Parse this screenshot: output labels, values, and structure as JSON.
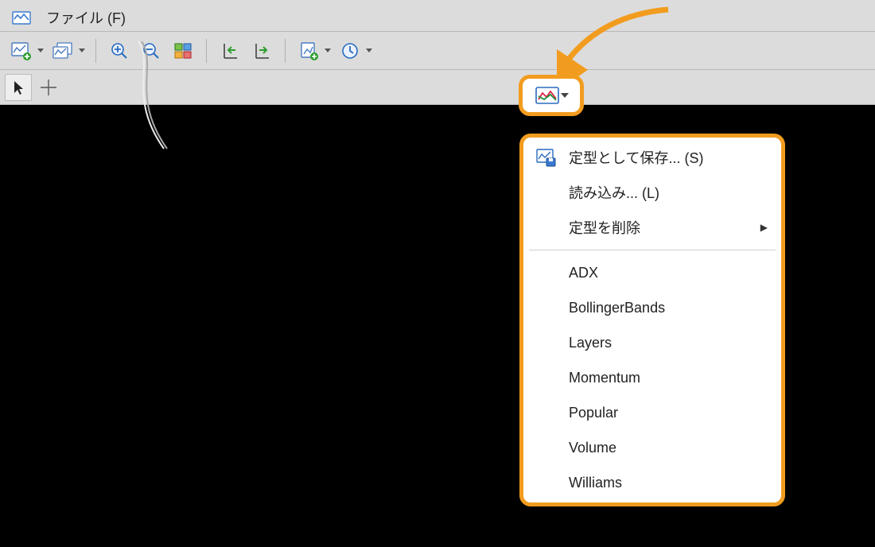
{
  "menubar": {
    "file_label": "ファイル (F)"
  },
  "dropdown": {
    "save_as": "定型として保存... (S)",
    "load": "読み込み... (L)",
    "delete": "定型を削除",
    "templates": [
      "ADX",
      "BollingerBands",
      "Layers",
      "Momentum",
      "Popular",
      "Volume",
      "Williams"
    ]
  },
  "colors": {
    "highlight": "#f29c1f"
  }
}
